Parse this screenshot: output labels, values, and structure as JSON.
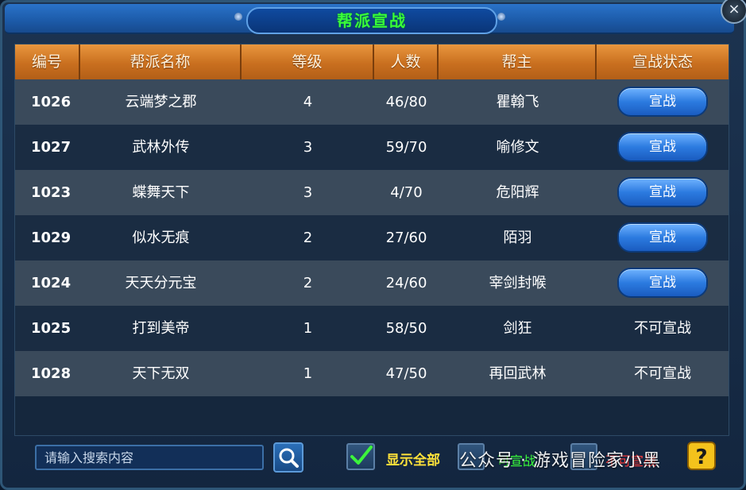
{
  "window": {
    "title": "帮派宣战",
    "close_glyph": "×"
  },
  "table": {
    "headers": [
      "编号",
      "帮派名称",
      "等级",
      "人数",
      "帮主",
      "宣战状态"
    ],
    "rows": [
      {
        "id": "1026",
        "name": "云端梦之郡",
        "level": "4",
        "members": "46/80",
        "leader": "瞿翰飞",
        "status": "宣战",
        "can_declare": true
      },
      {
        "id": "1027",
        "name": "武林外传",
        "level": "3",
        "members": "59/70",
        "leader": "喻修文",
        "status": "宣战",
        "can_declare": true
      },
      {
        "id": "1023",
        "name": "蝶舞天下",
        "level": "3",
        "members": "4/70",
        "leader": "危阳辉",
        "status": "宣战",
        "can_declare": true
      },
      {
        "id": "1029",
        "name": "似水无痕",
        "level": "2",
        "members": "27/60",
        "leader": "陌羽",
        "status": "宣战",
        "can_declare": true
      },
      {
        "id": "1024",
        "name": "天天分元宝",
        "level": "2",
        "members": "24/60",
        "leader": "宰剑封喉",
        "status": "宣战",
        "can_declare": true
      },
      {
        "id": "1025",
        "name": "打到美帝",
        "level": "1",
        "members": "58/50",
        "leader": "剑狂",
        "status": "不可宣战",
        "can_declare": false
      },
      {
        "id": "1028",
        "name": "天下无双",
        "level": "1",
        "members": "47/50",
        "leader": "再回武林",
        "status": "不可宣战",
        "can_declare": false
      }
    ]
  },
  "bottom": {
    "search_placeholder": "请输入搜索内容",
    "show_all_label": "显示全部",
    "filter_label_1": "可宣战",
    "filter_label_2": "不可宣战",
    "watermark": "公众号 · 游戏冒险家小黑",
    "help_glyph": "?"
  },
  "colors": {
    "title_text": "#39ff39",
    "header_bg": "#d67d2a",
    "declare_button": "#2c7be0",
    "show_all_text": "#ffe23a"
  }
}
